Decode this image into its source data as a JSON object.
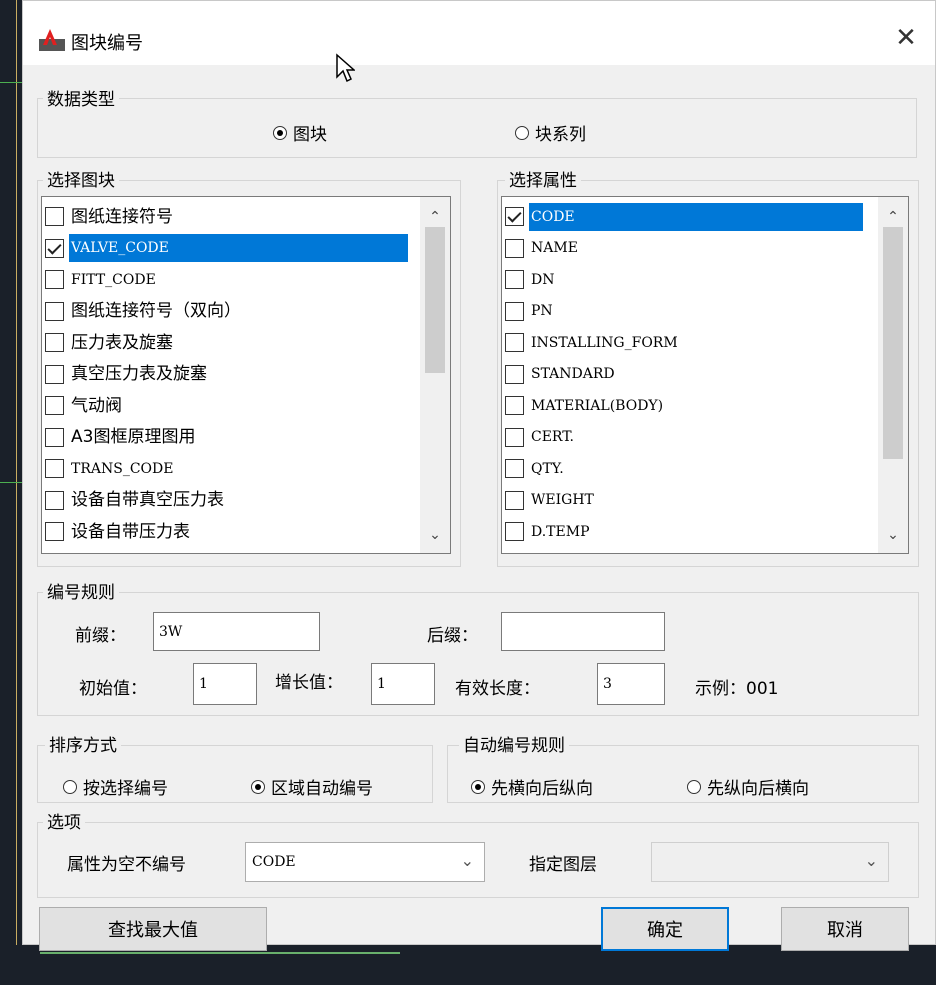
{
  "window": {
    "title": "图块编号",
    "close_glyph": "✕"
  },
  "data_type": {
    "label": "数据类型",
    "options": [
      {
        "label": "图块",
        "selected": true
      },
      {
        "label": "块系列",
        "selected": false
      }
    ]
  },
  "block_list": {
    "label": "选择图块",
    "items": [
      {
        "label": "图纸连接符号",
        "checked": false,
        "selected": false
      },
      {
        "label": "VALVE_CODE",
        "checked": true,
        "selected": true
      },
      {
        "label": "FITT_CODE",
        "checked": false,
        "selected": false
      },
      {
        "label": "图纸连接符号（双向）",
        "checked": false,
        "selected": false
      },
      {
        "label": "压力表及旋塞",
        "checked": false,
        "selected": false
      },
      {
        "label": "真空压力表及旋塞",
        "checked": false,
        "selected": false
      },
      {
        "label": "气动阀",
        "checked": false,
        "selected": false
      },
      {
        "label": "A3图框原理图用",
        "checked": false,
        "selected": false
      },
      {
        "label": "TRANS_CODE",
        "checked": false,
        "selected": false
      },
      {
        "label": "设备自带真空压力表",
        "checked": false,
        "selected": false
      },
      {
        "label": "设备自带压力表",
        "checked": false,
        "selected": false
      }
    ]
  },
  "attr_list": {
    "label": "选择属性",
    "items": [
      {
        "label": "CODE",
        "checked": true,
        "selected": true
      },
      {
        "label": "NAME",
        "checked": false,
        "selected": false
      },
      {
        "label": "DN",
        "checked": false,
        "selected": false
      },
      {
        "label": "PN",
        "checked": false,
        "selected": false
      },
      {
        "label": "INSTALLING_FORM",
        "checked": false,
        "selected": false
      },
      {
        "label": "STANDARD",
        "checked": false,
        "selected": false
      },
      {
        "label": "MATERIAL(BODY)",
        "checked": false,
        "selected": false
      },
      {
        "label": "CERT.",
        "checked": false,
        "selected": false
      },
      {
        "label": "QTY.",
        "checked": false,
        "selected": false
      },
      {
        "label": "WEIGHT",
        "checked": false,
        "selected": false
      },
      {
        "label": "D.TEMP",
        "checked": false,
        "selected": false
      }
    ]
  },
  "numbering": {
    "label": "编号规则",
    "prefix_label": "前缀：",
    "prefix_value": "3W",
    "suffix_label": "后缀：",
    "suffix_value": "",
    "start_label": "初始值：",
    "start_value": "1",
    "step_label": "增长值：",
    "step_value": "1",
    "length_label": "有效长度：",
    "length_value": "3",
    "example_label": "示例：001"
  },
  "sort": {
    "label": "排序方式",
    "options": [
      {
        "label": "按选择编号",
        "selected": false
      },
      {
        "label": "区域自动编号",
        "selected": true
      }
    ]
  },
  "auto_rule": {
    "label": "自动编号规则",
    "options": [
      {
        "label": "先横向后纵向",
        "selected": true
      },
      {
        "label": "先纵向后横向",
        "selected": false
      }
    ]
  },
  "options": {
    "label": "选项",
    "empty_attr_label": "属性为空不编号",
    "empty_attr_value": "CODE",
    "layer_label": "指定图层",
    "layer_value": ""
  },
  "buttons": {
    "find_max": "查找最大值",
    "ok": "确定",
    "cancel": "取消"
  }
}
